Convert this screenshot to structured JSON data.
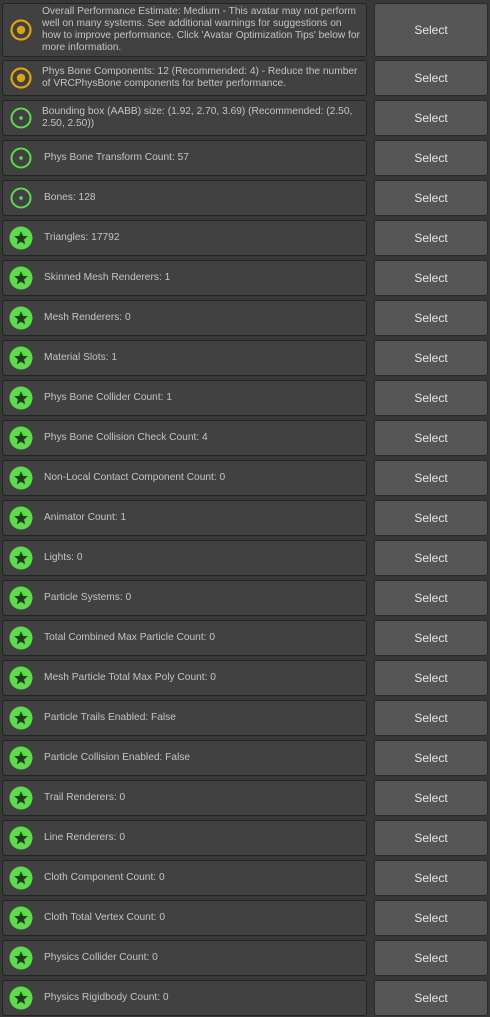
{
  "select_label": "Select",
  "colors": {
    "warning": "#e0a30f",
    "good": "#5ddb4d",
    "star": "#1e3f1a",
    "panel": "#414141",
    "button": "#565656"
  },
  "items": [
    {
      "status": "medium",
      "icon": "medium-warning-icon",
      "text": "Overall Performance Estimate: Medium - This avatar may not perform well on many systems. See additional warnings for suggestions on how to improve performance. Click 'Avatar Optimization Tips' below for more information."
    },
    {
      "status": "medium",
      "icon": "medium-warning-icon",
      "text": "Phys Bone Components: 12 (Recommended: 4) - Reduce the number of VRCPhysBone components for better performance."
    },
    {
      "status": "good",
      "icon": "good-ring-icon",
      "text": "Bounding box (AABB) size: (1.92, 2.70, 3.69) (Recommended: (2.50, 2.50, 2.50))"
    },
    {
      "status": "good",
      "icon": "good-ring-icon",
      "text": "Phys Bone Transform Count: 57"
    },
    {
      "status": "good",
      "icon": "good-ring-icon",
      "text": "Bones: 128"
    },
    {
      "status": "excellent",
      "icon": "excellent-star-icon",
      "text": "Triangles: 17792"
    },
    {
      "status": "excellent",
      "icon": "excellent-star-icon",
      "text": "Skinned Mesh Renderers: 1"
    },
    {
      "status": "excellent",
      "icon": "excellent-star-icon",
      "text": "Mesh Renderers: 0"
    },
    {
      "status": "excellent",
      "icon": "excellent-star-icon",
      "text": "Material Slots: 1"
    },
    {
      "status": "excellent",
      "icon": "excellent-star-icon",
      "text": "Phys Bone Collider Count: 1"
    },
    {
      "status": "excellent",
      "icon": "excellent-star-icon",
      "text": "Phys Bone Collision Check Count: 4"
    },
    {
      "status": "excellent",
      "icon": "excellent-star-icon",
      "text": "Non-Local Contact Component Count: 0"
    },
    {
      "status": "excellent",
      "icon": "excellent-star-icon",
      "text": "Animator Count: 1"
    },
    {
      "status": "excellent",
      "icon": "excellent-star-icon",
      "text": "Lights: 0"
    },
    {
      "status": "excellent",
      "icon": "excellent-star-icon",
      "text": "Particle Systems: 0"
    },
    {
      "status": "excellent",
      "icon": "excellent-star-icon",
      "text": "Total Combined Max Particle Count: 0"
    },
    {
      "status": "excellent",
      "icon": "excellent-star-icon",
      "text": "Mesh Particle Total Max Poly Count: 0"
    },
    {
      "status": "excellent",
      "icon": "excellent-star-icon",
      "text": "Particle Trails Enabled: False"
    },
    {
      "status": "excellent",
      "icon": "excellent-star-icon",
      "text": "Particle Collision Enabled: False"
    },
    {
      "status": "excellent",
      "icon": "excellent-star-icon",
      "text": "Trail Renderers: 0"
    },
    {
      "status": "excellent",
      "icon": "excellent-star-icon",
      "text": "Line Renderers: 0"
    },
    {
      "status": "excellent",
      "icon": "excellent-star-icon",
      "text": "Cloth Component Count: 0"
    },
    {
      "status": "excellent",
      "icon": "excellent-star-icon",
      "text": "Cloth Total Vertex Count: 0"
    },
    {
      "status": "excellent",
      "icon": "excellent-star-icon",
      "text": "Physics Collider Count: 0"
    },
    {
      "status": "excellent",
      "icon": "excellent-star-icon",
      "text": "Physics Rigidbody Count: 0"
    }
  ]
}
